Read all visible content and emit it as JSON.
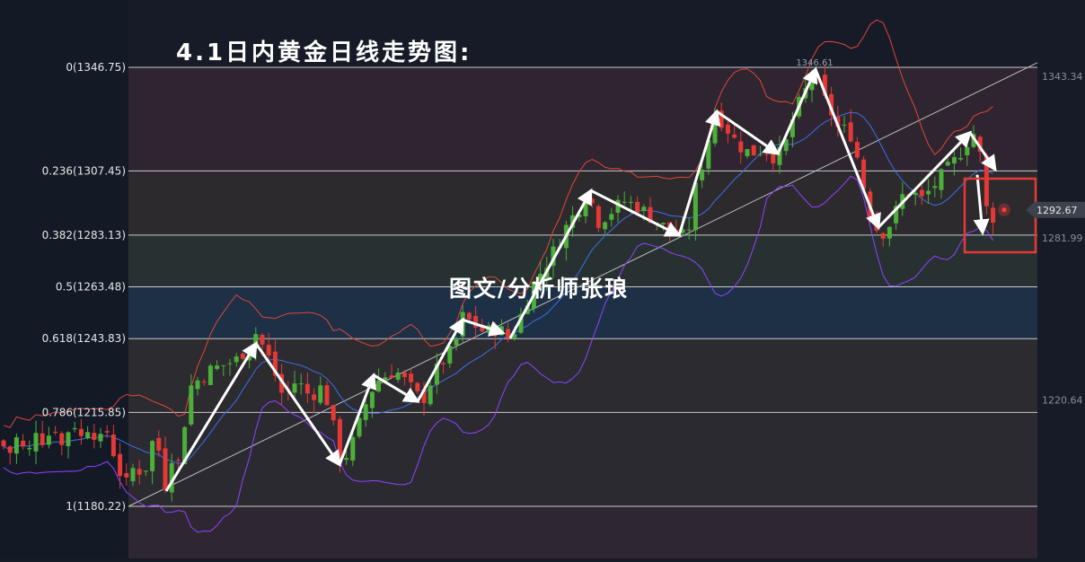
{
  "title": "4.1日内黄金日线走势图:",
  "watermark": "图文/分析师张琅",
  "chart_data": {
    "type": "candlestick",
    "title": "4.1日内黄金日线走势图:",
    "ylim": [
      1170,
      1356
    ],
    "fib_levels": [
      {
        "label": "0(1346.75)",
        "ratio": 0,
        "price": 1346.75
      },
      {
        "label": "0.236(1307.45)",
        "ratio": 0.236,
        "price": 1307.45
      },
      {
        "label": "0.382(1283.13)",
        "ratio": 0.382,
        "price": 1283.13
      },
      {
        "label": "0.5(1263.48)",
        "ratio": 0.5,
        "price": 1263.48
      },
      {
        "label": "0.618(1243.83)",
        "ratio": 0.618,
        "price": 1243.83
      },
      {
        "label": "0.786(1215.85)",
        "ratio": 0.786,
        "price": 1215.85
      },
      {
        "label": "1(1180.22)",
        "ratio": 1,
        "price": 1180.22
      }
    ],
    "right_axis_labels": [
      "1343.34",
      "1281.99",
      "1220.64"
    ],
    "current_price": "1292.67",
    "high_annotation": "1346.61",
    "colors": {
      "up": "#4caf3a",
      "down": "#e53935",
      "upper_band": "#e0473a",
      "lower_band": "#8e44ff",
      "middle_band": "#3f6fe8",
      "highlight": "#e53935"
    }
  }
}
